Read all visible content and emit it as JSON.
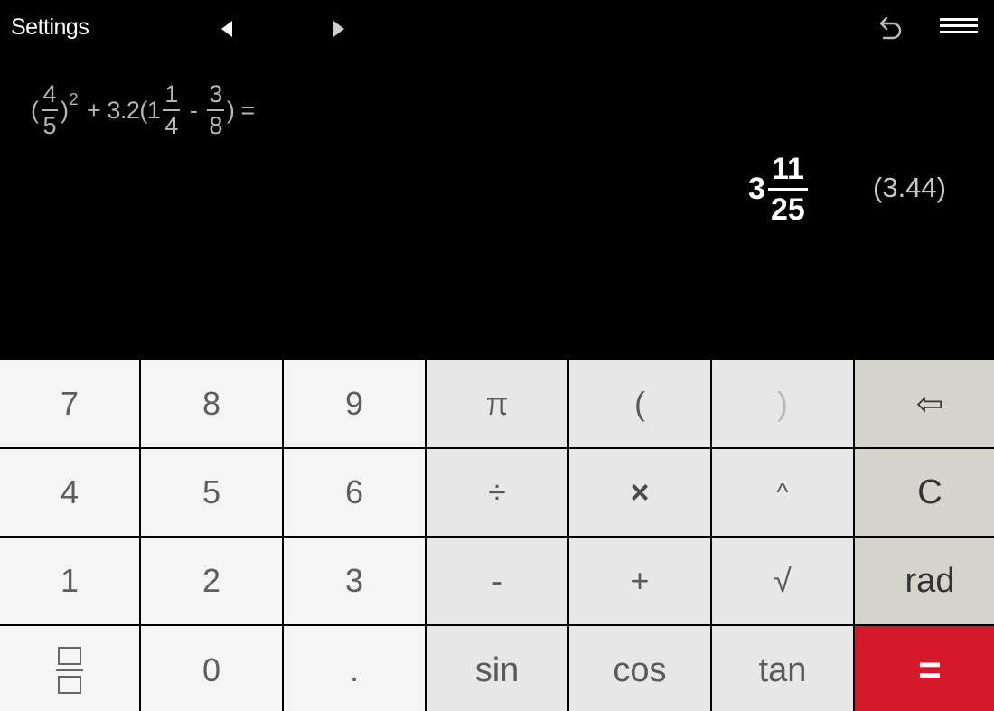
{
  "topbar": {
    "settings_label": "Settings",
    "prev_icon": "triangle-left-icon",
    "next_icon": "triangle-right-icon",
    "undo_icon": "undo-icon",
    "menu_icon": "hamburger-menu-icon"
  },
  "expression": {
    "open1": "(",
    "f1_num": "4",
    "f1_den": "5",
    "close1": ")",
    "exp": "2",
    "plus_part": "+ 3.2(1",
    "f2_num": "1",
    "f2_den": "4",
    "minus": "-",
    "f3_num": "3",
    "f3_den": "8",
    "tail": ") ="
  },
  "result": {
    "whole": "3",
    "num": "11",
    "den": "25",
    "decimal": "(3.44)"
  },
  "keypad": {
    "k7": "7",
    "k8": "8",
    "k9": "9",
    "pi": "π",
    "lparen": "(",
    "rparen": ")",
    "backspace": "⇦",
    "k4": "4",
    "k5": "5",
    "k6": "6",
    "divide": "÷",
    "multiply": "×",
    "power": "^",
    "clear": "C",
    "k1": "1",
    "k2": "2",
    "k3": "3",
    "minus": "-",
    "plus": "+",
    "sqrt": "√",
    "rad": "rad",
    "fraction_icon": "fraction-icon",
    "k0": "0",
    "dot": ".",
    "sin": "sin",
    "cos": "cos",
    "tan": "tan",
    "equals": "="
  },
  "colors": {
    "background": "#000000",
    "equals_key": "#d4192b",
    "digit_key": "#f5f5f5",
    "operator_key": "#e7e7e7",
    "function_key": "#d4d3cc"
  }
}
